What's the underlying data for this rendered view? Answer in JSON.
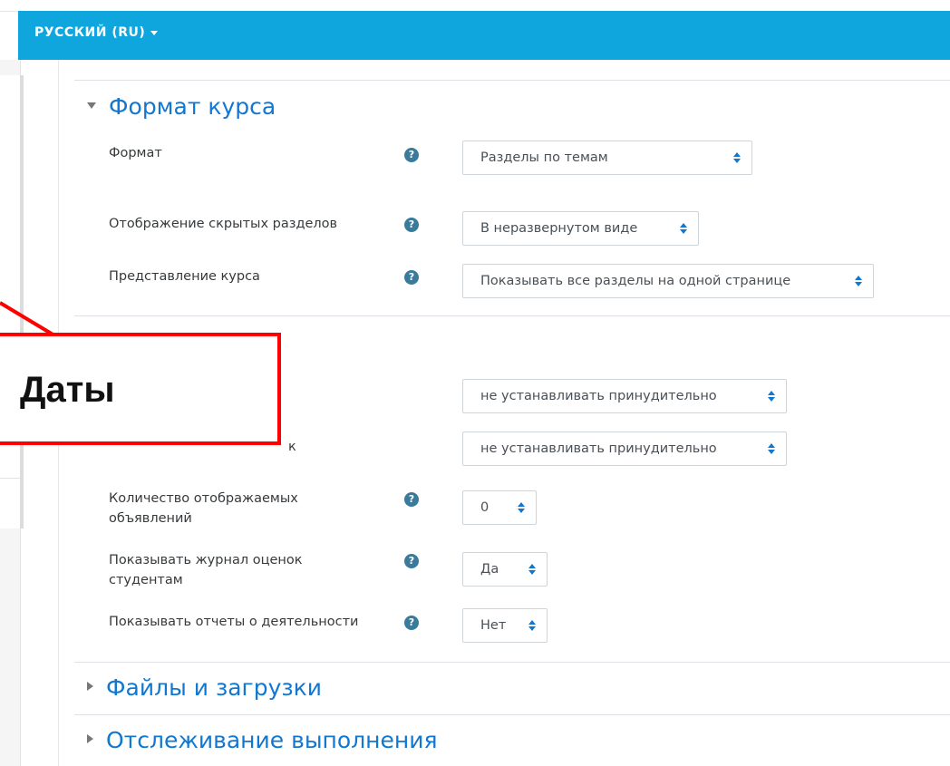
{
  "navbar": {
    "language": "РУССКИЙ (RU)"
  },
  "sections": {
    "course_format": {
      "title": "Формат курса",
      "fields": {
        "format": {
          "label": "Формат",
          "value": "Разделы по темам"
        },
        "hidden_sections": {
          "label": "Отображение скрытых разделов",
          "value": "В неразвернутом виде"
        },
        "course_layout": {
          "label": "Представление курса",
          "value": "Показывать все разделы на одной странице"
        }
      }
    },
    "appearance": {
      "fields": {
        "force_language": {
          "value": "не устанавливать принудительно"
        },
        "force_theme": {
          "label_partial": "к",
          "value": "не устанавливать принудительно"
        },
        "news_items": {
          "label": "Количество отображаемых объявлений",
          "value": "0"
        },
        "show_grades": {
          "label": "Показывать журнал оценок студентам",
          "value": "Да"
        },
        "show_reports": {
          "label": "Показывать отчеты о деятельности",
          "value": "Нет"
        }
      }
    },
    "files": {
      "title": "Файлы и загрузки"
    },
    "completion": {
      "title": "Отслеживание выполнения"
    }
  },
  "callout": {
    "text": "Даты"
  },
  "icons": {
    "help": "question-circle-icon",
    "help_glyph": "?",
    "select": "up-down-arrows-icon"
  },
  "colors": {
    "navbar": "#0ea6dd",
    "link": "#1177d1",
    "callout_border": "#ff0000",
    "help_icon": "#3a7b9c"
  }
}
